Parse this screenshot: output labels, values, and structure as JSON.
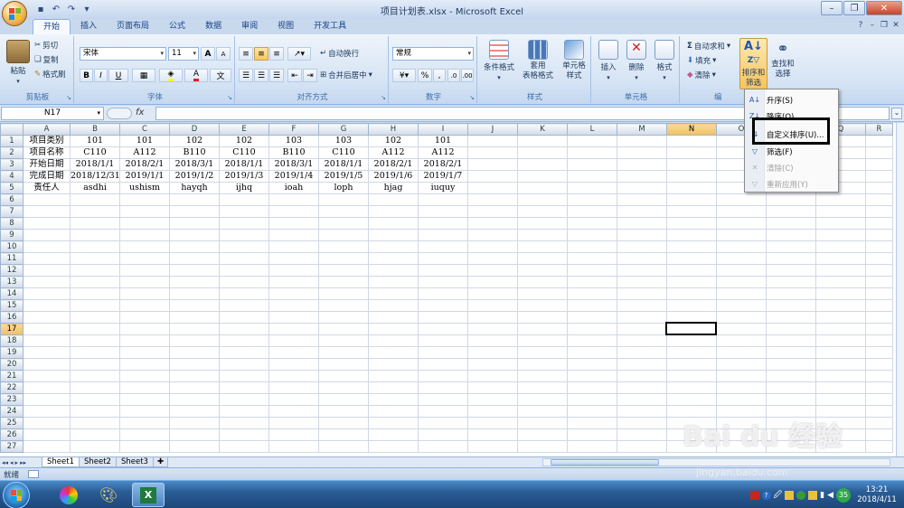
{
  "window": {
    "title": "项目计划表.xlsx - Microsoft Excel"
  },
  "tabs": [
    "开始",
    "插入",
    "页面布局",
    "公式",
    "数据",
    "审阅",
    "视图",
    "开发工具"
  ],
  "ribbon": {
    "clipboard": {
      "paste": "粘贴",
      "cut": "剪切",
      "copy": "复制",
      "format_painter": "格式刷",
      "group": "剪贴板"
    },
    "font": {
      "name": "宋体",
      "size": "11",
      "bold": "B",
      "italic": "I",
      "underline": "U",
      "grow": "A",
      "shrink": "A",
      "group": "字体"
    },
    "alignment": {
      "wrap": "自动换行",
      "merge": "合并后居中",
      "group": "对齐方式"
    },
    "number": {
      "format": "常规",
      "percent": "%",
      "comma": ",",
      "group": "数字"
    },
    "styles": {
      "conditional": "条件格式",
      "table": "套用\n表格格式",
      "cell_styles": "单元格\n样式",
      "group": "样式"
    },
    "cells": {
      "insert": "插入",
      "delete": "删除",
      "format": "格式",
      "group": "单元格"
    },
    "editing": {
      "autosum": "自动求和",
      "fill": "填充",
      "clear": "清除",
      "sort": "排序和\n筛选",
      "find": "查找和\n选择",
      "group": "编"
    }
  },
  "formula_bar": {
    "name_box": "N17",
    "fx": "fx",
    "value": ""
  },
  "columns": [
    "A",
    "B",
    "C",
    "D",
    "E",
    "F",
    "G",
    "H",
    "I",
    "J",
    "K",
    "L",
    "M",
    "N",
    "O",
    "P",
    "Q",
    "R"
  ],
  "rows": [
    [
      "项目类别",
      "101",
      "101",
      "102",
      "102",
      "103",
      "103",
      "102",
      "101"
    ],
    [
      "项目名称",
      "C110",
      "A112",
      "B110",
      "C110",
      "B110",
      "C110",
      "A112",
      "A112"
    ],
    [
      "开始日期",
      "2018/1/1",
      "2018/2/1",
      "2018/3/1",
      "2018/1/1",
      "2018/3/1",
      "2018/1/1",
      "2018/2/1",
      "2018/2/1"
    ],
    [
      "完成日期",
      "2018/12/31",
      "2019/1/1",
      "2019/1/2",
      "2019/1/3",
      "2019/1/4",
      "2019/1/5",
      "2019/1/6",
      "2019/1/7"
    ],
    [
      "责任人",
      "asdhi",
      "ushism",
      "hayqh",
      "ijhq",
      "ioah",
      "loph",
      "hjag",
      "iuquy"
    ]
  ],
  "row_count": 27,
  "selected_col": "N",
  "selected_row": 17,
  "sheets": [
    "Sheet1",
    "Sheet2",
    "Sheet3"
  ],
  "status": "就绪",
  "sort_menu": {
    "items": [
      {
        "label": "升序(S)",
        "icon": "A↓",
        "enabled": true
      },
      {
        "label": "降序(O)",
        "icon": "Z↓",
        "enabled": true
      },
      {
        "label": "自定义排序(U)...",
        "icon": "⇅",
        "enabled": true
      },
      {
        "label": "筛选(F)",
        "icon": "▽",
        "enabled": true
      },
      {
        "label": "清除(C)",
        "icon": "✕",
        "enabled": false
      },
      {
        "label": "重新应用(Y)",
        "icon": "▽",
        "enabled": false
      }
    ]
  },
  "taskbar": {
    "time": "13:21",
    "date": "2018/4/11",
    "badge": "35"
  },
  "watermark": {
    "text": "Bai du 经验",
    "url": "jingyan.baidu.com"
  },
  "colors": {
    "ribbon_top": "#eef4fb",
    "accent": "#1e395b",
    "header_sel": "#f1c15f",
    "taskbar": "#2a5d96"
  }
}
